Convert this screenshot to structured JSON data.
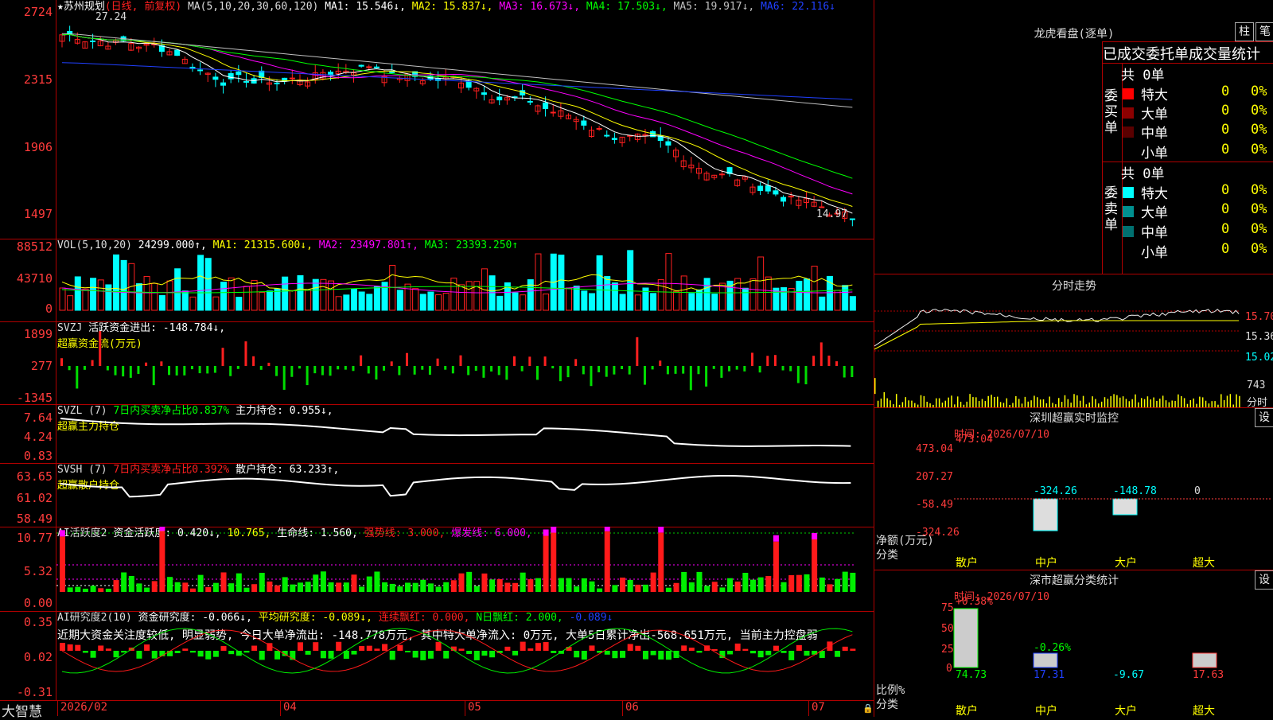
{
  "main_chart": {
    "title_star": "★",
    "stock_name": "苏州规划",
    "mode": "(日线, 前复权)",
    "ma_header": "MA(5,10,20,30,60,120)",
    "ma1": "MA1: 15.546↓,",
    "ma2": "MA2: 15.837↓,",
    "ma3": "MA3: 16.673↓,",
    "ma4": "MA4: 17.503↓,",
    "ma5": "MA5: 19.917↓,",
    "ma6": "MA6: 22.116↓",
    "y_labels": [
      "2724",
      "2315",
      "1906",
      "1497"
    ],
    "high_label": "27.24",
    "low_label": "14.97",
    "colors": {
      "up": "#ff2020",
      "down": "#00ffff",
      "ma1": "#ffffff",
      "ma2": "#ffff00",
      "ma3": "#ff00ff",
      "ma4": "#00ff00",
      "ma5": "#c0c0c0",
      "ma6": "#2040ff"
    }
  },
  "vol_chart": {
    "header": "VOL(5,10,20)",
    "value": "24299.000↑,",
    "ma1": "MA1: 21315.600↓,",
    "ma2": "MA2: 23497.801↑,",
    "ma3": "MA3: 23393.250↑",
    "y_labels": [
      "88512",
      "43710",
      "0"
    ]
  },
  "svzj": {
    "header": "SVZJ",
    "label": "活跃资金进出: -148.784↓,",
    "subtitle": "超赢资金流(万元)",
    "y_labels": [
      "1899",
      "277",
      "-1345"
    ]
  },
  "svzl": {
    "header": "SVZL (7)",
    "pct": "7日内买卖净占比0.837%",
    "hold": "主力持仓: 0.955↓,",
    "subtitle": "超赢主力持仓",
    "y_labels": [
      "7.64",
      "4.24",
      "0.83"
    ]
  },
  "svsh": {
    "header": "SVSH (7)",
    "pct": "7日内买卖净占比0.392%",
    "hold": "散户持仓: 63.233↑,",
    "subtitle": "超赢散户持仓",
    "y_labels": [
      "63.65",
      "61.02",
      "58.49"
    ]
  },
  "ai_active": {
    "header": "AI活跃度2",
    "a": "资金活跃度: 0.420↓,",
    "b": "10.765,",
    "c": "生命线: 1.560,",
    "d": "强势线: 3.000,",
    "e": "爆发线: 6.000,",
    "y_labels": [
      "10.77",
      "5.32",
      "0.00"
    ]
  },
  "ai_research": {
    "header": "AI研究度2(10)",
    "a": "资金研究度: -0.066↓,",
    "b": "平均研究度: -0.089↓,",
    "c": "连续飘红: 0.000,",
    "d": "N日飘红: 2.000,",
    "e": "-0.089↓",
    "comment": "近期大资金关注度较低, 明显弱势, 今日大单净流出: -148.778万元, 其中特大单净流入: 0万元, 大单5日累计净出-568.651万元, 当前主力控盘弱",
    "y_labels": [
      "0.35",
      "0.02",
      "-0.31"
    ]
  },
  "xaxis": {
    "brand": "大智慧",
    "labels": [
      "2026/02",
      "04",
      "05",
      "06",
      "07"
    ]
  },
  "dragon": {
    "title": "龙虎看盘(逐单)",
    "btn_bar": "柱",
    "btn_pen": "笔",
    "table_title": "已成交委托单成交量统计",
    "buy_label": "委买单",
    "sell_label": "委卖单",
    "buy_total": "共 0单",
    "sell_total": "共 0单",
    "rows": [
      "特大",
      "大单",
      "中单",
      "小单"
    ],
    "count": "0",
    "pct": "0%"
  },
  "intraday": {
    "title": "分时走势",
    "y_labels": [
      "15.70",
      "15.36",
      "15.02"
    ],
    "vol_label": "743",
    "vol_sub": "分时"
  },
  "sz_monitor": {
    "title": "深圳超赢实时监控",
    "btn": "设",
    "time": "时间: 2026/07/10",
    "y_labels": [
      "473.04",
      "207.27",
      "-58.49",
      "-324.26"
    ],
    "values": [
      "473.04",
      "-324.26",
      "-148.78",
      "0"
    ],
    "cats": [
      "散户",
      "中户",
      "大户",
      "超大"
    ],
    "ylab": "净额(万元)",
    "xlab": "分类"
  },
  "sz_class": {
    "title": "深市超赢分类统计",
    "btn": "设",
    "time": "时间: 2026/07/10",
    "y_labels": [
      "75",
      "50",
      "25",
      "0"
    ],
    "top_vals": [
      "+0.38%",
      "-0.26%"
    ],
    "values": [
      "74.73",
      "17.31",
      "-9.67",
      "17.63"
    ],
    "cats": [
      "散户",
      "中户",
      "大户",
      "超大"
    ],
    "ylab": "比例%",
    "xlab": "分类"
  }
}
